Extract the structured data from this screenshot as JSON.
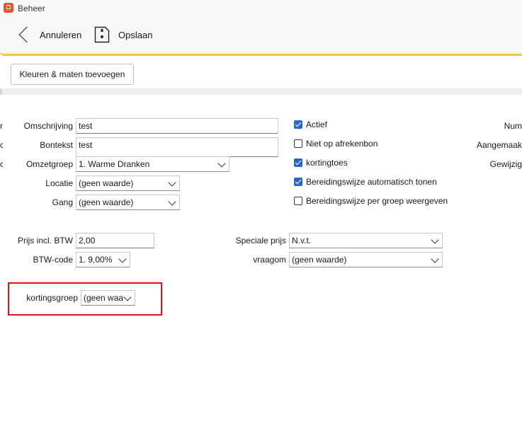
{
  "window": {
    "title": "Beheer"
  },
  "toolbar": {
    "cancel_label": "Annuleren",
    "save_label": "Opslaan"
  },
  "actions": {
    "add_colors_sizes": "Kleuren & maten toevoegen"
  },
  "form": {
    "left_edge_fragments": [
      "n",
      "c",
      "c"
    ],
    "omschrijving": {
      "label": "Omschrijving",
      "value": "test"
    },
    "bontekst": {
      "label": "Bontekst",
      "value": "test"
    },
    "omzetgroep": {
      "label": "Omzetgroep",
      "value": "1. Warme Dranken"
    },
    "locatie": {
      "label": "Locatie",
      "value": "(geen waarde)"
    },
    "gang": {
      "label": "Gang",
      "value": "(geen waarde)"
    },
    "prijs": {
      "label": "Prijs incl. BTW",
      "value": "2,00"
    },
    "btw_code": {
      "label": "BTW-code",
      "value": "1. 9,00%"
    },
    "speciale_prijs": {
      "label": "Speciale prijs",
      "value": "N.v.t."
    },
    "vraagom": {
      "label": "vraagom",
      "value": "(geen waarde)"
    },
    "kortingsgroep": {
      "label": "kortingsgroep",
      "value": "(geen waa"
    }
  },
  "checkboxes": [
    {
      "label": "Actief",
      "checked": true
    },
    {
      "label": "Niet op afrekenbon",
      "checked": false
    },
    {
      "label": "kortingtoes",
      "checked": true
    },
    {
      "label": "Bereidingswijze automatisch tonen",
      "checked": true
    },
    {
      "label": "Bereidingswijze per groep weergeven",
      "checked": false
    }
  ],
  "right_column": {
    "num": "Num",
    "aangemaakt": "Aangemaak",
    "gewijzigd": "Gewijzig"
  },
  "colors": {
    "accent_yellow": "#f4c542",
    "checkbox_blue": "#2a67c9",
    "highlight_red": "#e8101b",
    "app_icon": "#e8552c"
  }
}
